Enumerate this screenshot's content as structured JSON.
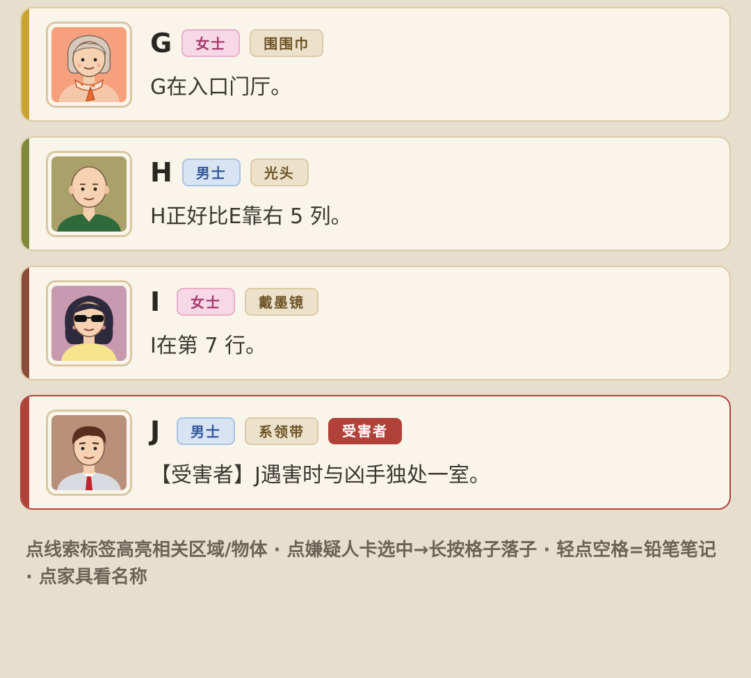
{
  "suspects": [
    {
      "name": "G",
      "gender": "女士",
      "trait": "围围巾",
      "clue": "G在入口门厅。",
      "accent": "#c9a230",
      "avatar": "elderly-woman-scarf-icon"
    },
    {
      "name": "H",
      "gender": "男士",
      "trait": "光头",
      "clue": "H正好比E靠右 5 列。",
      "accent": "#7e8a3a",
      "avatar": "bald-man-icon"
    },
    {
      "name": "I",
      "gender": "女士",
      "trait": "戴墨镜",
      "clue": "I在第 7 行。",
      "accent": "#8a4b3a",
      "avatar": "woman-sunglasses-icon"
    },
    {
      "name": "J",
      "gender": "男士",
      "trait": "系领带",
      "victim": "受害者",
      "clue": "【受害者】J遇害时与凶手独处一室。",
      "accent": "#b2413a",
      "avatar": "man-tie-icon"
    }
  ],
  "hint": "点线索标签高亮相关区域/物体 · 点嫌疑人卡选中→长按格子落子 · 轻点空格=铅笔笔记 · 点家具看名称",
  "colors": {
    "background": "#e6dfcd",
    "card": "#faf5ea",
    "female_tag": "#f7d8e6",
    "male_tag": "#d8e4f4",
    "trait_tag": "#ece2cc",
    "victim": "#b2413a"
  }
}
